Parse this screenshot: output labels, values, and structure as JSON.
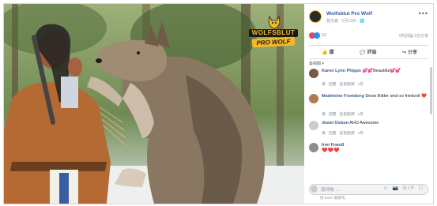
{
  "photo": {
    "logo_top": "WOLFSBLUT",
    "logo_bottom": "PRO WOLF"
  },
  "post": {
    "page_name": "Wolfsblut Pro Wolf",
    "meta": "發文者 · 1月13日 · 🌐",
    "more": "•••",
    "reaction_count": "62",
    "stats": "6則評論 2次分享",
    "actions": {
      "like": "讚",
      "comment": "評論",
      "share": "分享"
    },
    "filter": "最相關 ▾"
  },
  "comments": [
    {
      "name": "Karen Lynn Phipps",
      "text": " 💕💕Beautiful💕💕",
      "meta": [
        "讚",
        "回覆",
        "查看翻譯",
        "1年"
      ]
    },
    {
      "name": "Madeleine Fromberg",
      "text": " Diese Bilder sind so friedvoll ❤️",
      "meta": [
        "讚",
        "回覆",
        "查看翻譯",
        "1年"
      ]
    },
    {
      "name": "Jewel Osbon",
      "text": " AHO Awesome",
      "meta": [
        "讚",
        "回覆",
        "查看翻譯",
        "1年"
      ]
    },
    {
      "name": "Irmi Frandl",
      "text": "❤️❤️❤️",
      "meta": []
    }
  ],
  "composer": {
    "placeholder": "寫評論……",
    "hint": "按 Enter 鍵發布。",
    "icons": "☺ 📷 GIF ☐"
  },
  "colors": {
    "link": "#385898",
    "gold": "#f3b92a"
  }
}
